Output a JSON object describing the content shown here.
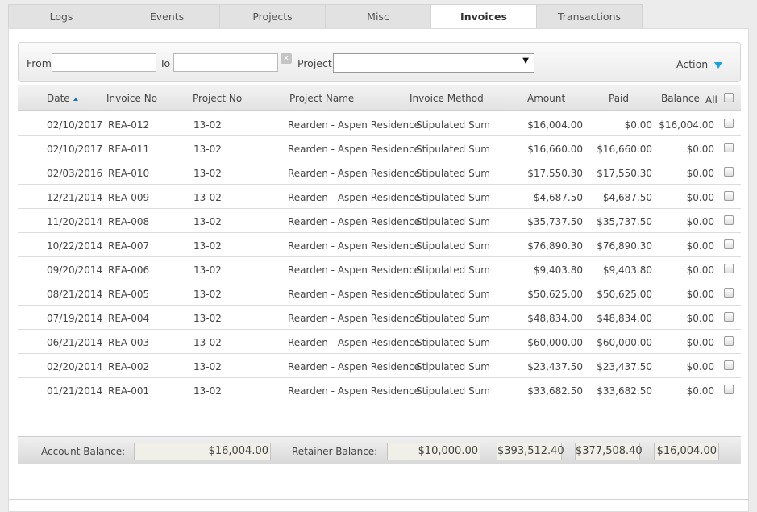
{
  "tabs": [
    {
      "label": "Logs",
      "active": false
    },
    {
      "label": "Events",
      "active": false
    },
    {
      "label": "Projects",
      "active": false
    },
    {
      "label": "Misc",
      "active": false
    },
    {
      "label": "Invoices",
      "active": true
    },
    {
      "label": "Transactions",
      "active": false
    }
  ],
  "filters": {
    "from_label": "From",
    "from_value": "",
    "to_label": "To",
    "to_value": "",
    "clear_glyph": "×",
    "project_label": "Project",
    "project_value": "",
    "dropdown_arrow": "▼",
    "action_label": "Action"
  },
  "columns": {
    "date": "Date",
    "invoice_no": "Invoice No",
    "project_no": "Project No",
    "project_name": "Project Name",
    "invoice_method": "Invoice Method",
    "amount": "Amount",
    "paid": "Paid",
    "balance": "Balance",
    "all": "All"
  },
  "rows": [
    {
      "date": "02/10/2017",
      "invoice_no": "REA-012",
      "project_no": "13-02",
      "project_name": "Rearden - Aspen Residence",
      "invoice_method": "Stipulated Sum",
      "amount": "$16,004.00",
      "paid": "$0.00",
      "balance": "$16,004.00"
    },
    {
      "date": "02/10/2017",
      "invoice_no": "REA-011",
      "project_no": "13-02",
      "project_name": "Rearden - Aspen Residence",
      "invoice_method": "Stipulated Sum",
      "amount": "$16,660.00",
      "paid": "$16,660.00",
      "balance": "$0.00"
    },
    {
      "date": "02/03/2016",
      "invoice_no": "REA-010",
      "project_no": "13-02",
      "project_name": "Rearden - Aspen Residence",
      "invoice_method": "Stipulated Sum",
      "amount": "$17,550.30",
      "paid": "$17,550.30",
      "balance": "$0.00"
    },
    {
      "date": "12/21/2014",
      "invoice_no": "REA-009",
      "project_no": "13-02",
      "project_name": "Rearden - Aspen Residence",
      "invoice_method": "Stipulated Sum",
      "amount": "$4,687.50",
      "paid": "$4,687.50",
      "balance": "$0.00"
    },
    {
      "date": "11/20/2014",
      "invoice_no": "REA-008",
      "project_no": "13-02",
      "project_name": "Rearden - Aspen Residence",
      "invoice_method": "Stipulated Sum",
      "amount": "$35,737.50",
      "paid": "$35,737.50",
      "balance": "$0.00"
    },
    {
      "date": "10/22/2014",
      "invoice_no": "REA-007",
      "project_no": "13-02",
      "project_name": "Rearden - Aspen Residence",
      "invoice_method": "Stipulated Sum",
      "amount": "$76,890.30",
      "paid": "$76,890.30",
      "balance": "$0.00"
    },
    {
      "date": "09/20/2014",
      "invoice_no": "REA-006",
      "project_no": "13-02",
      "project_name": "Rearden - Aspen Residence",
      "invoice_method": "Stipulated Sum",
      "amount": "$9,403.80",
      "paid": "$9,403.80",
      "balance": "$0.00"
    },
    {
      "date": "08/21/2014",
      "invoice_no": "REA-005",
      "project_no": "13-02",
      "project_name": "Rearden - Aspen Residence",
      "invoice_method": "Stipulated Sum",
      "amount": "$50,625.00",
      "paid": "$50,625.00",
      "balance": "$0.00"
    },
    {
      "date": "07/19/2014",
      "invoice_no": "REA-004",
      "project_no": "13-02",
      "project_name": "Rearden - Aspen Residence",
      "invoice_method": "Stipulated Sum",
      "amount": "$48,834.00",
      "paid": "$48,834.00",
      "balance": "$0.00"
    },
    {
      "date": "06/21/2014",
      "invoice_no": "REA-003",
      "project_no": "13-02",
      "project_name": "Rearden - Aspen Residence",
      "invoice_method": "Stipulated Sum",
      "amount": "$60,000.00",
      "paid": "$60,000.00",
      "balance": "$0.00"
    },
    {
      "date": "02/20/2014",
      "invoice_no": "REA-002",
      "project_no": "13-02",
      "project_name": "Rearden - Aspen Residence",
      "invoice_method": "Stipulated Sum",
      "amount": "$23,437.50",
      "paid": "$23,437.50",
      "balance": "$0.00"
    },
    {
      "date": "01/21/2014",
      "invoice_no": "REA-001",
      "project_no": "13-02",
      "project_name": "Rearden - Aspen Residence",
      "invoice_method": "Stipulated Sum",
      "amount": "$33,682.50",
      "paid": "$33,682.50",
      "balance": "$0.00"
    }
  ],
  "footer": {
    "account_balance_label": "Account Balance:",
    "account_balance": "$16,004.00",
    "retainer_balance_label": "Retainer Balance:",
    "retainer_balance": "$10,000.00",
    "total_amount": "$393,512.40",
    "total_paid": "$377,508.40",
    "total_balance": "$16,004.00"
  },
  "colors": {
    "accent": "#1ba1e2",
    "sort_indicator": "#1a6fb0"
  }
}
